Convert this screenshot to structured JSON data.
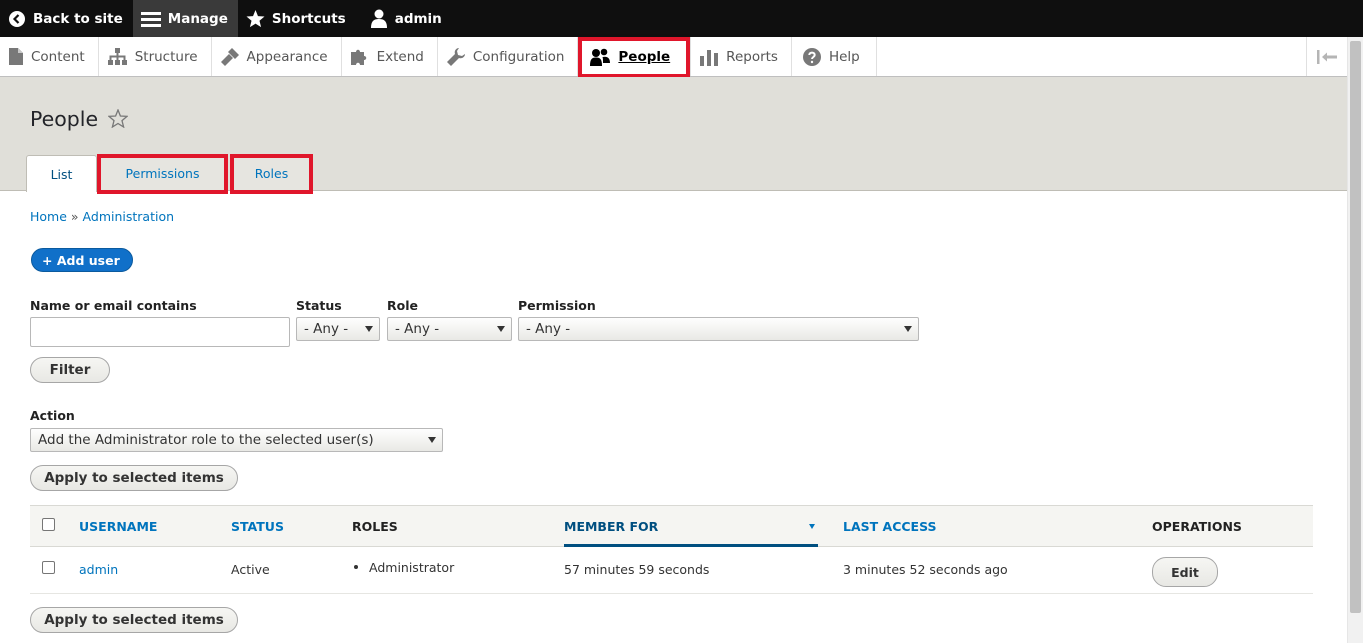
{
  "toolbar": {
    "back_label": "Back to site",
    "manage_label": "Manage",
    "shortcuts_label": "Shortcuts",
    "user_label": "admin"
  },
  "tray": {
    "items": [
      {
        "label": "Content",
        "icon": "file-icon"
      },
      {
        "label": "Structure",
        "icon": "sitemap-icon"
      },
      {
        "label": "Appearance",
        "icon": "paintbrush-icon"
      },
      {
        "label": "Extend",
        "icon": "puzzle-icon"
      },
      {
        "label": "Configuration",
        "icon": "wrench-icon"
      },
      {
        "label": "People",
        "icon": "people-icon",
        "active": true
      },
      {
        "label": "Reports",
        "icon": "bar-chart-icon"
      },
      {
        "label": "Help",
        "icon": "help-icon"
      }
    ],
    "highlight_color": "#e0162b"
  },
  "page": {
    "title": "People",
    "tabs": [
      {
        "label": "List",
        "active": true
      },
      {
        "label": "Permissions"
      },
      {
        "label": "Roles"
      }
    ]
  },
  "breadcrumb": {
    "home": "Home",
    "separator": "»",
    "admin": "Administration"
  },
  "add_user_label": "+ Add user",
  "filter": {
    "name_label": "Name or email contains",
    "name_value": "",
    "status_label": "Status",
    "status_value": "- Any -",
    "role_label": "Role",
    "role_value": "- Any -",
    "permission_label": "Permission",
    "permission_value": "- Any -",
    "button_label": "Filter"
  },
  "action": {
    "label": "Action",
    "value": "Add the Administrator role to the selected user(s)",
    "apply_label": "Apply to selected items"
  },
  "table": {
    "headers": {
      "username": "USERNAME",
      "status": "STATUS",
      "roles": "ROLES",
      "member_for": "MEMBER FOR",
      "last_access": "LAST ACCESS",
      "operations": "OPERATIONS"
    },
    "rows": [
      {
        "username": "admin",
        "status": "Active",
        "role": "Administrator",
        "member_for": "57 minutes 59 seconds",
        "last_access": "3 minutes 52 seconds ago",
        "operation": "Edit"
      }
    ]
  },
  "colors": {
    "accent": "#0074bd",
    "primary_button": "#1070c9",
    "toolbar": "#0f0f0f",
    "header_bg": "#e0dfd9"
  }
}
